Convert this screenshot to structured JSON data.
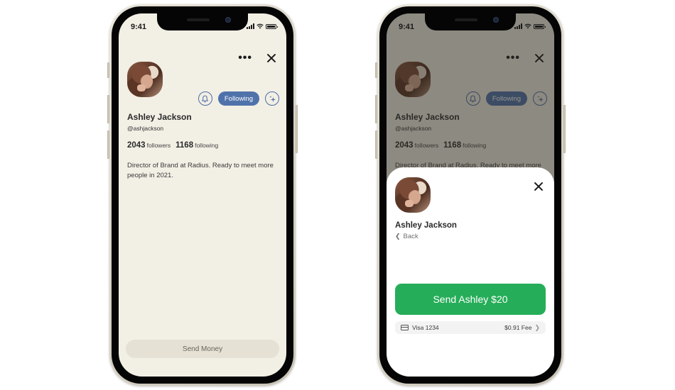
{
  "status_bar": {
    "time": "9:41"
  },
  "profile": {
    "name": "Ashley Jackson",
    "handle": "@ashjackson",
    "followers_count": "2043",
    "followers_label": "followers",
    "following_count": "1168",
    "following_label": "following",
    "bio": "Director of Brand at Radius. Ready to meet more people in 2021.",
    "follow_state_label": "Following",
    "more_icon": "more-horizontal-icon",
    "close_icon": "close-icon",
    "bell_icon": "bell-icon",
    "sparkle_icon": "sparkle-icon"
  },
  "left_screen": {
    "send_money_label": "Send Money"
  },
  "send_sheet": {
    "name": "Ashley Jackson",
    "back_label": "Back",
    "send_button_label": "Send Ashley $20",
    "payment_method": "Visa 1234",
    "fee": "$0.91 Fee"
  },
  "colors": {
    "screen_bg": "#f2efe5",
    "accent_blue": "#5072ab",
    "send_green": "#26ad59",
    "send_money_bg": "#e5e1d4"
  }
}
